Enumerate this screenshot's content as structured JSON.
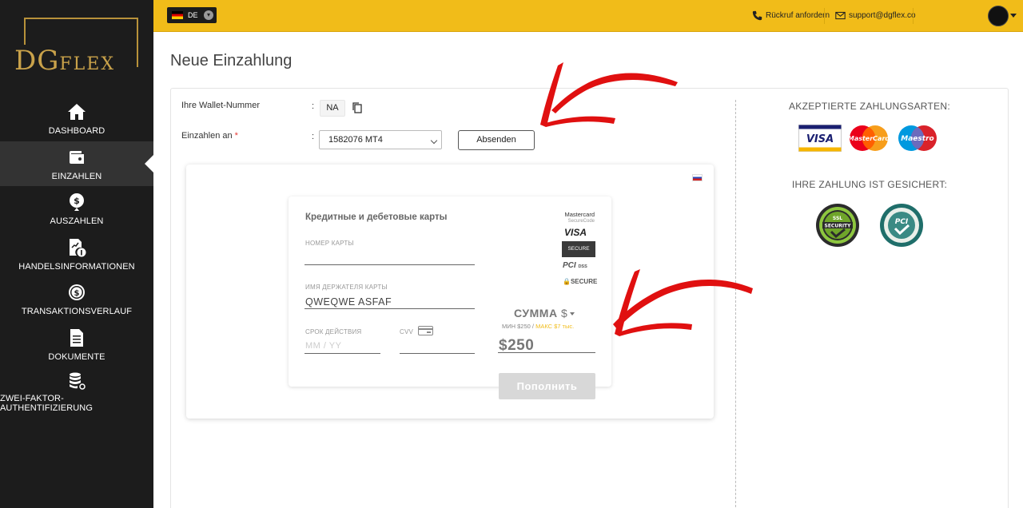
{
  "brand": {
    "logo_main": "DG",
    "logo_small": "FLEX"
  },
  "sidebar": {
    "items": [
      {
        "label": "DASHBOARD",
        "icon": "home-icon",
        "active": false
      },
      {
        "label": "EINZAHLEN",
        "icon": "wallet-icon",
        "active": true
      },
      {
        "label": "AUSZAHLEN",
        "icon": "dollar-coin-icon",
        "active": false
      },
      {
        "label": "HANDELSINFORMATIONEN",
        "icon": "info-document-icon",
        "active": false
      },
      {
        "label": "TRANSAKTIONSVERLAUF",
        "icon": "history-coin-icon",
        "active": false
      },
      {
        "label": "DOKUMENTE",
        "icon": "document-icon",
        "active": false
      },
      {
        "label": "ZWEI-FAKTOR-AUTHENTIFIZIERUNG",
        "icon": "database-key-icon",
        "active": false
      }
    ]
  },
  "topbar": {
    "language": "DE",
    "callback_label": "Rückruf anfordern",
    "support_email": "support@dgflex.co"
  },
  "page": {
    "title": "Neue Einzahlung"
  },
  "form": {
    "wallet_label": "Ihre Wallet-Nummer",
    "wallet_value": "NA",
    "deposit_label": "Einzahlen an",
    "required_mark": "*",
    "deposit_selected": "1582076 MT4",
    "submit_label": "Absenden",
    "colon": ":"
  },
  "payment_card": {
    "title": "Кредитные и дебетовые карты",
    "card_number_label": "НОМЕР КАРТЫ",
    "card_number_value": "",
    "holder_label": "ИМЯ ДЕРЖАТЕЛЯ КАРТЫ",
    "holder_value": "QWEQWE ASFAF",
    "expiry_label": "СРОК ДЕЙСТВИЯ",
    "expiry_placeholder": "MM / YY",
    "cvv_label": "CVV",
    "badges": {
      "mastercard": "Mastercard",
      "mastercard_sub": "SecureCode",
      "visa": "VISA",
      "visa_secure": "SECURE",
      "pci": "PCI",
      "pci_sub": "DSS",
      "secure": "SECURE"
    },
    "sum_label": "СУММА",
    "currency": "$",
    "min_label": "МИН $250 /",
    "max_label": "МАКС $7 тыс.",
    "amount": "$250",
    "pay_button": "Пополнить"
  },
  "right_panel": {
    "accepted_title": "AKZEPTIERTE ZAHLUNGSARTEN:",
    "secured_title": "IHRE ZAHLUNG IST GESICHERT:",
    "card_logos": {
      "visa": "VISA",
      "mastercard": "MasterCard",
      "maestro": "Maestro"
    },
    "seals": {
      "ssl_top": "SSL",
      "ssl_main": "SECURITY",
      "pci_text": "PCI"
    }
  },
  "colors": {
    "accent_yellow": "#f1bc19",
    "sidebar_bg": "#1c1c1c",
    "logo_gold": "#c9a24a",
    "annotation_red": "#e01010"
  }
}
